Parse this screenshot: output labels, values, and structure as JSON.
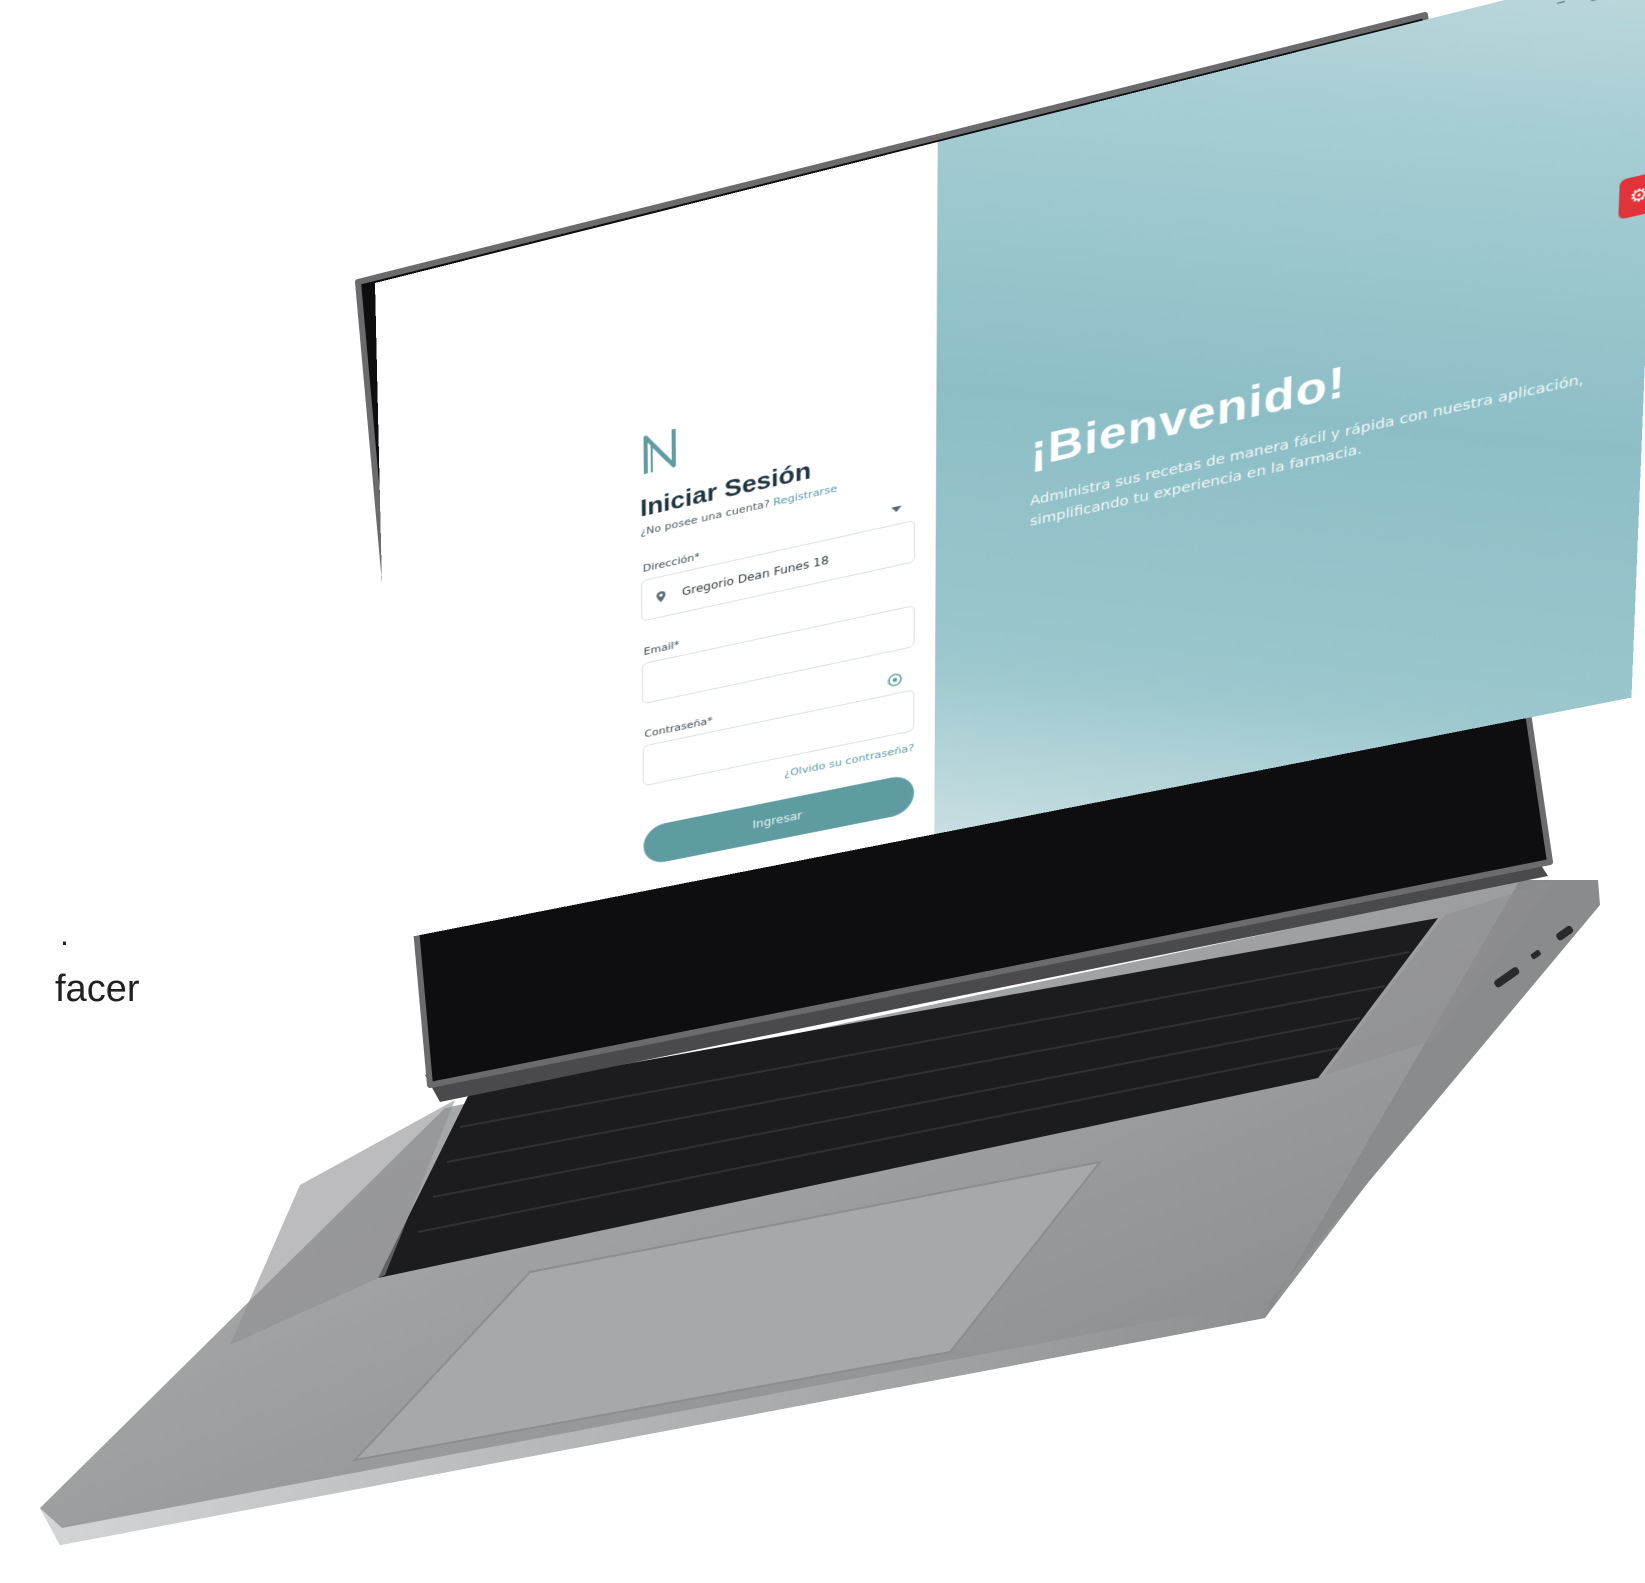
{
  "slide": {
    "fragment_top": ".",
    "fragment_text": "facer"
  },
  "window": {
    "minimize": "–",
    "maximize": "▢",
    "close": "✕"
  },
  "login": {
    "title": "Iniciar Sesión",
    "no_account": "¿No posee una cuenta?",
    "register_link": "Registrarse",
    "address_label": "Dirección*",
    "address_value": "Gregorio Dean Funes 18",
    "email_label": "Email*",
    "email_value": "",
    "password_label": "Contraseña*",
    "password_value": "",
    "forgot_link": "¿Olvido su contraseña?",
    "submit_label": "Ingresar"
  },
  "welcome": {
    "title": "¡Bienvenido!",
    "text": "Administra sus recetas de manera fácil y rápida con nuestra aplicación, simplificando tu experiencia en la farmacia."
  },
  "icons": {
    "logo": "n-logo-icon",
    "address": "location-pin-icon",
    "dropdown": "chevron-down-icon",
    "password_toggle": "eye-icon",
    "settings": "gear-icon"
  },
  "colors": {
    "primary": "#5e9ca2",
    "link": "#5a9aa3",
    "heading": "#1f3440",
    "settings": "#e2333a",
    "panel": "#8dbec6"
  }
}
